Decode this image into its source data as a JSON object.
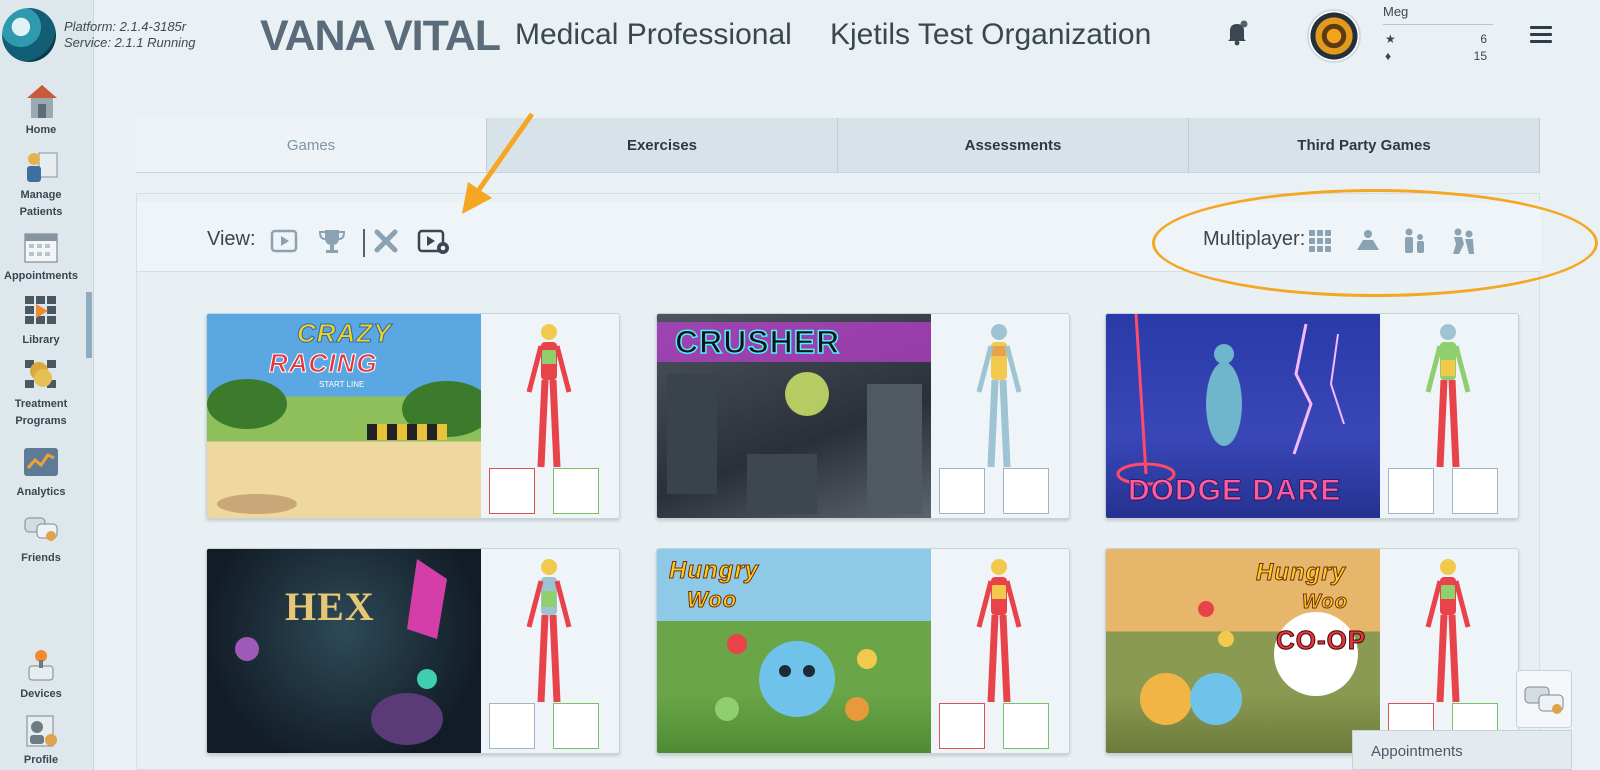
{
  "platform": {
    "platform_line": "Platform: 2.1.4-3185r",
    "service_line": "Service:   2.1.1 Running"
  },
  "header": {
    "brand": "VANA VITAL",
    "role": "Medical Professional",
    "organization": "Kjetils Test Organization"
  },
  "user": {
    "name": "Meg",
    "stars": "6",
    "gems": "15"
  },
  "sidebar": {
    "items": [
      {
        "label": "Home",
        "icon": "home-icon"
      },
      {
        "label": "Manage Patients",
        "icon": "manage-patients-icon"
      },
      {
        "label": "Appointments",
        "icon": "calendar-icon"
      },
      {
        "label": "Library",
        "icon": "library-icon"
      },
      {
        "label": "Treatment Programs",
        "icon": "treatment-programs-icon"
      },
      {
        "label": "Analytics",
        "icon": "analytics-icon"
      },
      {
        "label": "Friends",
        "icon": "friends-icon"
      },
      {
        "label": "Devices",
        "icon": "devices-icon"
      },
      {
        "label": "Profile",
        "icon": "profile-icon"
      }
    ],
    "active": "Library"
  },
  "tabs": [
    {
      "label": "Games",
      "active": true
    },
    {
      "label": "Exercises"
    },
    {
      "label": "Assessments"
    },
    {
      "label": "Third Party Games"
    }
  ],
  "view": {
    "label": "View:",
    "icons": [
      "play-icon",
      "trophy-icon",
      "tools-icon",
      "video-settings-icon"
    ]
  },
  "multiplayer": {
    "label": "Multiplayer:",
    "icons": [
      "grid-icon",
      "single-player-icon",
      "two-players-icon",
      "coop-players-icon"
    ]
  },
  "games": [
    {
      "title_line1": "CRAZY",
      "title_line2": "RACING",
      "sub": "START LINE"
    },
    {
      "title_line1": "CRUSHER"
    },
    {
      "title_line1": "DODGE DARE"
    },
    {
      "title_line1": "HEX"
    },
    {
      "title_line1": "Hungry",
      "title_line2": "Woo"
    },
    {
      "title_line1": "Hungry",
      "title_line2": "Woo",
      "title_line3": "CO-OP"
    }
  ],
  "bottom": {
    "appointments_label": "Appointments"
  },
  "colors": {
    "accent": "#f5a623",
    "active_tab_text": "#7d95a6",
    "body_red": "#e8434a",
    "body_yellow": "#f2c94c",
    "body_green": "#8fcf6e",
    "body_blue": "#9ec3d2"
  }
}
